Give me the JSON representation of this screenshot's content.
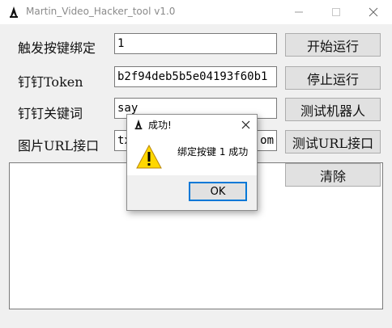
{
  "window": {
    "title": "Martin_Video_Hacker_tool v1.0",
    "controls": {
      "minimize": "─",
      "maximize": "☐",
      "close": "✕"
    }
  },
  "form": {
    "trigger_key": {
      "label": "触发按键绑定",
      "value": "1"
    },
    "dingtalk_token": {
      "label": "钉钉Token",
      "value": "b2f94deb5b5e04193f60b1"
    },
    "dingtalk_keyword": {
      "label": "钉钉关键词",
      "value": "say"
    },
    "image_url_endpoint": {
      "label": "图片URL接口",
      "value": "tx",
      "value_tail": "om"
    }
  },
  "buttons": {
    "start": "开始运行",
    "stop": "停止运行",
    "test_robot": "测试机器人",
    "test_url": "测试URL接口",
    "clear": "清除"
  },
  "log": {
    "content": ""
  },
  "dialog": {
    "title": "成功!",
    "message": "绑定按键 1 成功",
    "ok_label": "OK",
    "close": "✕"
  },
  "colors": {
    "accent": "#0078d7",
    "warning": "#ffd700"
  }
}
